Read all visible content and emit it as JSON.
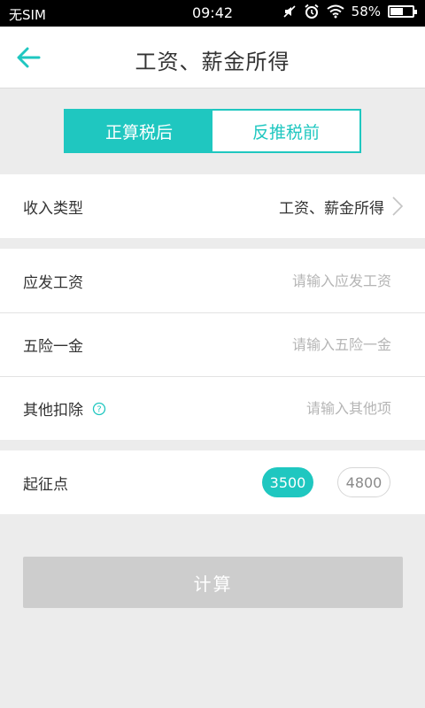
{
  "status_bar": {
    "carrier": "无SIM",
    "time": "09:42",
    "battery": "58%",
    "battery_level": 0.58,
    "icons": [
      "mute-icon",
      "alarm-icon",
      "wifi-icon",
      "battery-icon"
    ]
  },
  "header": {
    "title": "工资、薪金所得",
    "back_icon": "back-arrow-icon"
  },
  "segment": {
    "options": [
      "正算税后",
      "反推税前"
    ],
    "selected": "正算税后"
  },
  "income_type": {
    "label": "收入类型",
    "value": "工资、薪金所得"
  },
  "fields": [
    {
      "label": "应发工资",
      "placeholder": "请输入应发工资"
    },
    {
      "label": "五险一金",
      "placeholder": "请输入五险一金"
    },
    {
      "label": "其他扣除",
      "placeholder": "请输入其他项"
    }
  ],
  "threshold": {
    "label": "起征点",
    "options": [
      "3500",
      "4800"
    ],
    "selected": "3500"
  },
  "calculate": {
    "label": "计算"
  },
  "colors": {
    "accent": "#1fc7c0",
    "disabled_button": "#cdcdcd",
    "background": "#ececec"
  }
}
